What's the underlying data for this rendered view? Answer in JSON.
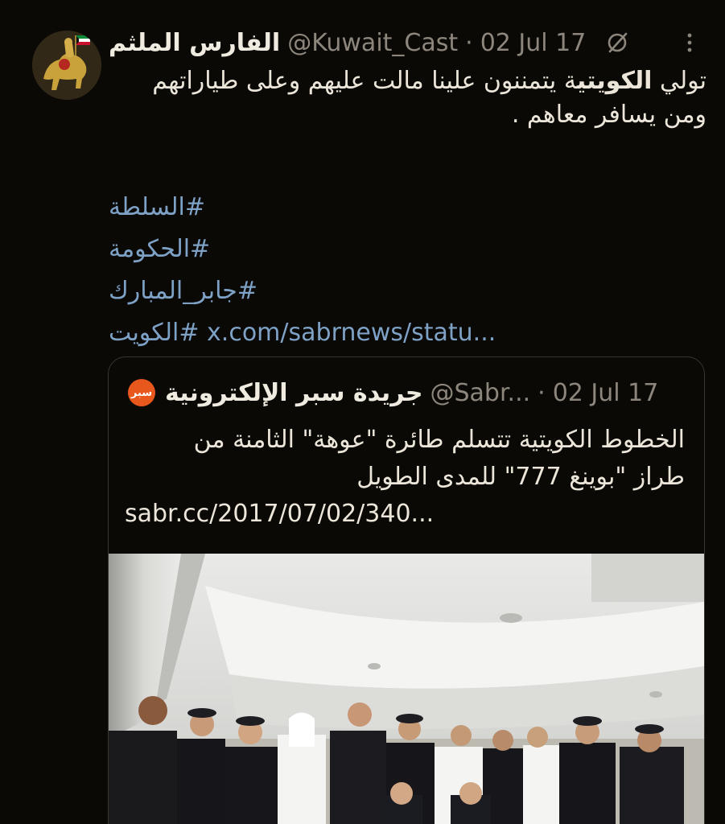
{
  "tweet": {
    "display_name": "الفارس الملثم",
    "handle": "@Kuwait_Cast",
    "separator": "·",
    "date": "02 Jul 17",
    "text_line1_pre": "تولي ",
    "text_line1_bold": "الكويتي",
    "text_line1_post": "ة يتمننون علينا مالت عليهم وعلى طياراتهم",
    "text_line2": "ومن يسافر معاهم .",
    "hashtags": [
      "#السلطة",
      "#الحكومة",
      "#جابر_المبارك",
      "#الكويت"
    ],
    "link": "x.com/sabrnews/statu..."
  },
  "icons": {
    "grok": "grok-slash-icon",
    "more": "more-vertical-icon",
    "avatar": "horseman-kuwait-flag-avatar"
  },
  "quote": {
    "avatar_label": "سبر",
    "display_name": "جريدة سبر الإلكترونية",
    "handle": "@Sabr...",
    "separator": "·",
    "date": "02 Jul 17",
    "text_line1": "الخطوط الكويتية تتسلم طائرة \"عوهة\" الثامنة من",
    "text_line2": "طراز \"بوينغ 777\" للمدى الطويل",
    "link": "sabr.cc/2017/07/02/340...",
    "image_alt": "Kuwait Airways crew and officials inside aircraft cabin"
  },
  "colors": {
    "background": "#0b0906",
    "text": "#ece6da",
    "muted": "#8c867c",
    "hashtag": "#7ea1c6",
    "sabr_orange": "#e8581c"
  }
}
